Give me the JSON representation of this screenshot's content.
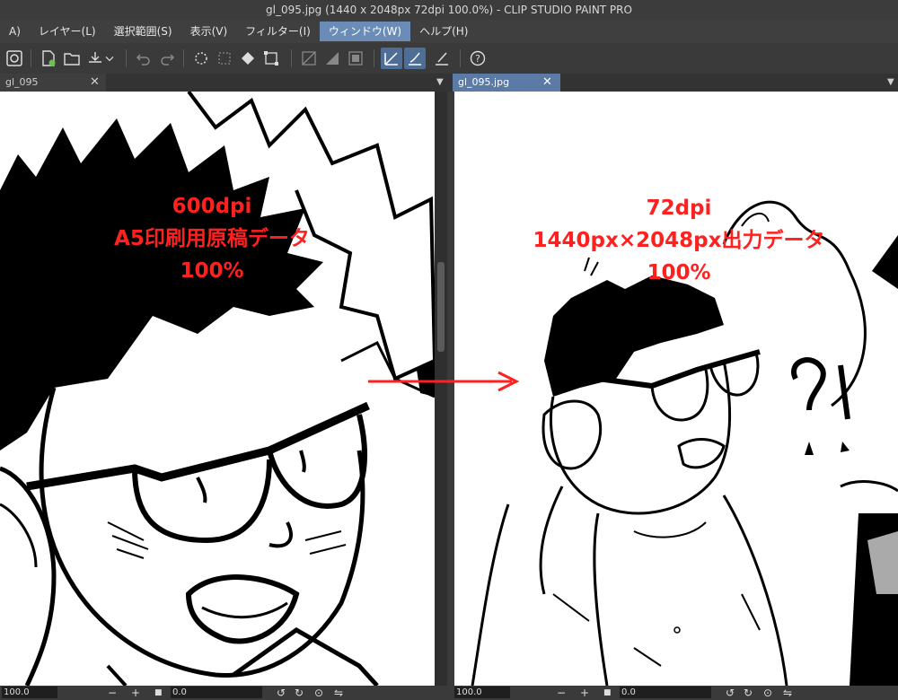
{
  "window": {
    "title": "gl_095.jpg (1440 x 2048px 72dpi 100.0%)  - CLIP STUDIO PAINT PRO"
  },
  "menu": [
    {
      "label": "A)",
      "active": false
    },
    {
      "label": "レイヤー(L)",
      "active": false
    },
    {
      "label": "選択範囲(S)",
      "active": false
    },
    {
      "label": "表示(V)",
      "active": false
    },
    {
      "label": "フィルター(I)",
      "active": false
    },
    {
      "label": "ウィンドウ(W)",
      "active": true
    },
    {
      "label": "ヘルプ(H)",
      "active": false
    }
  ],
  "toolbar_icons": [
    "clip-studio-icon",
    "new-file-icon",
    "open-file-icon",
    "save-icon",
    "undo-icon",
    "redo-icon",
    "loading-icon",
    "transform-icon",
    "fill-icon",
    "crop-icon",
    "ruler-off-icon",
    "snap-icon",
    "snap-grid-icon",
    "pen-snap-icon",
    "brush-snap-icon",
    "stroke-icon",
    "help-icon"
  ],
  "left_pane": {
    "tab": "gl_095",
    "overlay": [
      "600dpi",
      "A5印刷用原稿データ",
      "100%"
    ],
    "zoom": "100.0",
    "angle": "0.0"
  },
  "right_pane": {
    "tab": "gl_095.jpg",
    "overlay": [
      "72dpi",
      "1440px×2048px出力データ",
      "100%"
    ],
    "zoom": "100.0",
    "angle": "0.0"
  },
  "colors": {
    "overlay": "#ff2020",
    "active_menu": "#6a8cb6",
    "arrow": "#ff2020"
  }
}
